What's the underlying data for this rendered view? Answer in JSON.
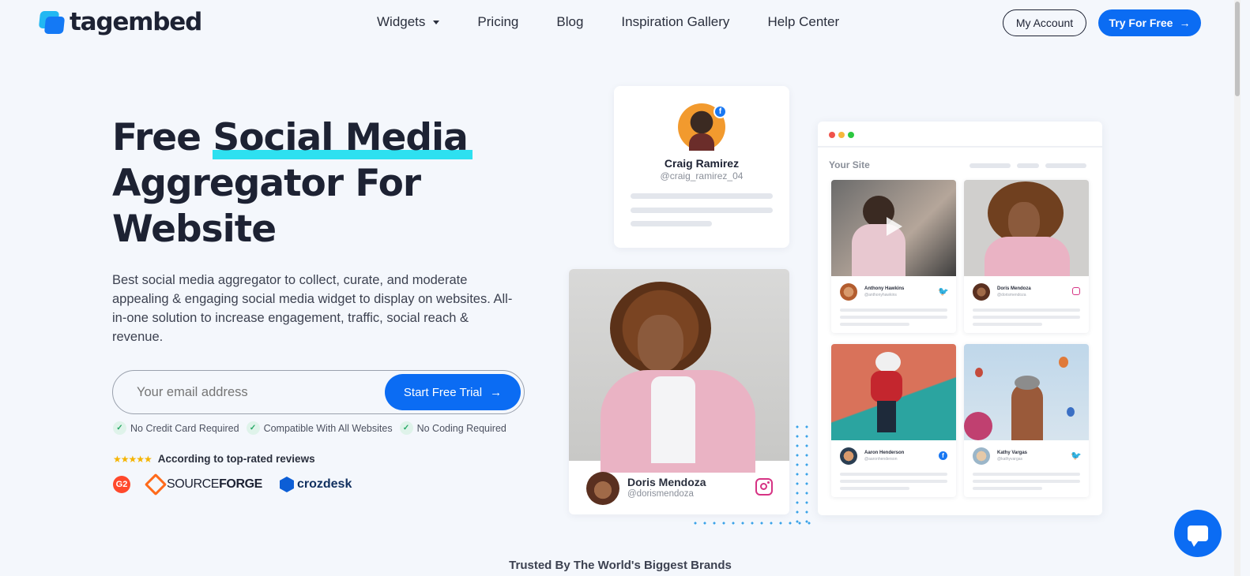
{
  "brand": {
    "name": "tagembed",
    "colors": {
      "primary": "#0b6cf3",
      "accent": "#2ee0f0",
      "dark": "#1d2233"
    }
  },
  "nav": {
    "items": [
      {
        "label": "Widgets",
        "has_dropdown": true
      },
      {
        "label": "Pricing"
      },
      {
        "label": "Blog"
      },
      {
        "label": "Inspiration Gallery"
      },
      {
        "label": "Help Center"
      }
    ],
    "account_label": "My Account",
    "try_label": "Try For Free",
    "try_icon": "arrow-right-icon"
  },
  "hero": {
    "title_prefix": "Free ",
    "title_highlight": "Social Media",
    "title_line2": "Aggregator For",
    "title_line3": "Website",
    "description": "Best social media aggregator to collect, curate, and moderate appealing & engaging social media widget to display on websites. All-in-one solution to increase engagement, traffic, social reach & revenue.",
    "email_placeholder": "Your email address",
    "cta_label": "Start Free Trial",
    "features": [
      {
        "icon": "check-icon",
        "label": "No Credit Card Required"
      },
      {
        "icon": "check-icon",
        "label": "Compatible With All Websites"
      },
      {
        "icon": "check-icon",
        "label": "No Coding Required"
      }
    ],
    "stars": "★★★★★",
    "rating_count": 5,
    "reviews_text": "According to top-rated reviews",
    "review_brands": {
      "g2": "G2",
      "sourceforge_light": "SOURCE",
      "sourceforge_bold": "FORGE",
      "crozdesk": "crozdesk"
    }
  },
  "mockup": {
    "craig": {
      "name": "Craig Ramirez",
      "handle": "@craig_ramirez_04",
      "network": "facebook"
    },
    "doris": {
      "name": "Doris Mendoza",
      "handle": "@dorismendoza",
      "network": "instagram"
    },
    "site": {
      "title": "Your Site",
      "posts": [
        {
          "name": "Anthony Hawkins",
          "handle": "@anthonyhawkins",
          "network": "twitter"
        },
        {
          "name": "Doris Mendoza",
          "handle": "@dorismendoza",
          "network": "instagram"
        },
        {
          "name": "Aaron Henderson",
          "handle": "@aaronhenderson",
          "network": "facebook"
        },
        {
          "name": "Kathy Vargas",
          "handle": "@kathyvargas",
          "network": "twitter"
        }
      ]
    }
  },
  "trusted_text": "Trusted By The World's Biggest Brands",
  "chat_icon": "chat-bubble-icon"
}
